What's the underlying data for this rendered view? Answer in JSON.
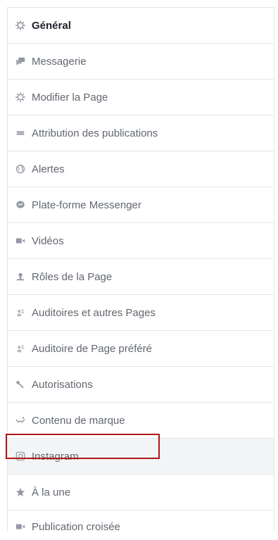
{
  "menu": {
    "items": [
      {
        "label": "Général",
        "icon": "gear-icon"
      },
      {
        "label": "Messagerie",
        "icon": "chat-icon"
      },
      {
        "label": "Modifier la Page",
        "icon": "gear-icon"
      },
      {
        "label": "Attribution des publications",
        "icon": "flag-icon"
      },
      {
        "label": "Alertes",
        "icon": "globe-icon"
      },
      {
        "label": "Plate-forme Messenger",
        "icon": "messenger-icon"
      },
      {
        "label": "Vidéos",
        "icon": "video-icon"
      },
      {
        "label": "Rôles de la Page",
        "icon": "person-icon"
      },
      {
        "label": "Auditoires et autres Pages",
        "icon": "people-icon"
      },
      {
        "label": "Auditoire de Page préféré",
        "icon": "people-icon"
      },
      {
        "label": "Autorisations",
        "icon": "wrench-icon"
      },
      {
        "label": "Contenu de marque",
        "icon": "handshake-icon"
      },
      {
        "label": "Instagram",
        "icon": "instagram-icon"
      },
      {
        "label": "À la une",
        "icon": "star-icon"
      },
      {
        "label": "Publication croisée",
        "icon": "video-icon"
      }
    ],
    "active_item": "Général",
    "highlighted_item": "Instagram"
  },
  "colors": {
    "highlight_border": "#b01718",
    "icon": "#9197a3",
    "text": "#61676f",
    "active_text": "#1d2129"
  }
}
